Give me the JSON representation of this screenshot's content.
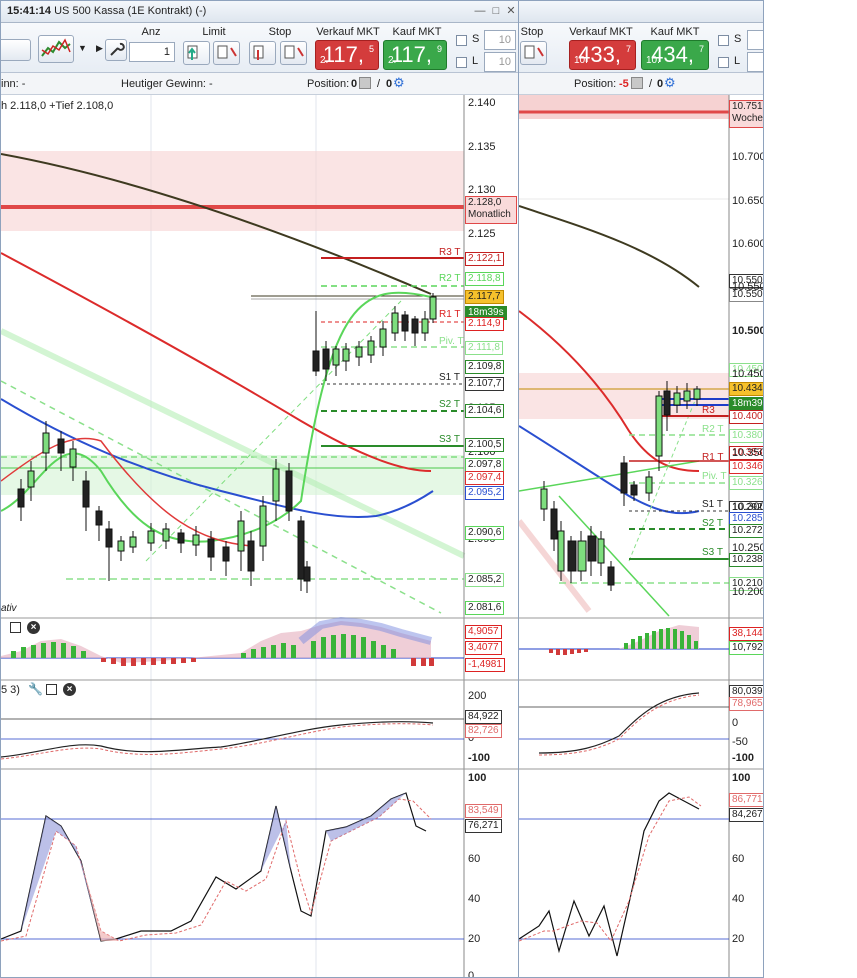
{
  "left_window": {
    "time": "15:41:14",
    "title": "US 500 Kassa (1E Kontrakt) (-)",
    "toolbar": {
      "anz_label": "Anz",
      "anz_value": "1",
      "limit_label": "Limit",
      "stop_label": "Stop",
      "sell_label": "Verkauf MKT",
      "buy_label": "Kauf MKT",
      "sell_small": "2.",
      "sell_big": "117,",
      "sell_sup": "5",
      "buy_small": "2.",
      "buy_big": "117,",
      "buy_sup": "9"
    },
    "infobar": {
      "gain_prefix": "inn:  -",
      "today_gain": "Heutiger Gewinn:  -",
      "position_label": "Position:",
      "position_value": "0",
      "position_value2": "0"
    },
    "chart_header": "h 2.118,0 +Tief 2.108,0",
    "price_axis": [
      "2.140",
      "2.135",
      "2.130",
      "2.125",
      "2.120",
      "2.115",
      "2.110",
      "2.105",
      "2.100",
      "2.095",
      "2.090",
      "2.085"
    ],
    "tags": {
      "monthly_value": "2.128,0",
      "monthly_label": "Monatlich",
      "r3": "2.122,1",
      "r2": "2.118,8",
      "last": "2.117,7",
      "timer": "18m39s",
      "r1": "2.114,9",
      "piv": "2.111,8",
      "a": "2.109,8",
      "s1": "2.107,7",
      "s2": "2.104,6",
      "s3": "2.100,5",
      "b": "2.097,8",
      "c": "2.097,4",
      "d": "2.095,2",
      "e": "2.090,6",
      "f": "2.085,2",
      "g": "2.081,6"
    },
    "pivot_labels": {
      "r3": "R3 T",
      "r2": "R2 T",
      "r1": "R1 T",
      "piv": "Piv. T",
      "s1": "S1 T",
      "s2": "S2 T",
      "s3": "S3 T"
    },
    "bottom_text": "ativ",
    "macd_tags": [
      "4,9057",
      "3,4077",
      "-1,4981"
    ],
    "cci_header": "5 3)",
    "cci_axis": [
      "200",
      "0",
      "-100"
    ],
    "cci_tags": [
      "84,922",
      "82,726"
    ],
    "stoch_axis": [
      "100",
      "60",
      "40",
      "20",
      "0"
    ],
    "stoch_tags": [
      "83,549",
      "76,271"
    ]
  },
  "right_window": {
    "toolbar": {
      "stop_label": "Stop",
      "sell_label": "Verkauf MKT",
      "buy_label": "Kauf MKT",
      "sell_small": "10.",
      "sell_big": "433,",
      "sell_sup": "7",
      "buy_small": "10.",
      "buy_big": "434,",
      "buy_sup": "7",
      "s_label": "S",
      "l_label": "L"
    },
    "infobar": {
      "position_label": "Position:",
      "position_value": "-5",
      "position_value2": "0"
    },
    "price_axis": [
      "10.700",
      "10.650",
      "10.600",
      "10.550",
      "10.500",
      "10.450",
      "10.350",
      "10.300",
      "10.250",
      "10.200"
    ],
    "tags": {
      "weekly_value": "10.751",
      "weekly_label": "Woche",
      "t550a": "10.550",
      "t550b": "10.550",
      "t450": "10.450",
      "last": "10.434",
      "timer": "18m39",
      "t400": "10.400",
      "t380": "10.380",
      "t353": "10.353",
      "t346": "10.346",
      "t326": "10.326",
      "t292": "10.292",
      "t285": "10.285",
      "t272": "10.272",
      "t238": "10.238",
      "t210": "10.210"
    },
    "pivot_labels": {
      "r3": "R3",
      "r2": "R2 T",
      "r1": "R1 T",
      "piv": "Piv. T",
      "s1": "S1 T",
      "s2": "S2 T",
      "s3": "S3 T"
    },
    "macd_tags": [
      "38,144",
      "10,792"
    ],
    "cci_axis": [
      "0",
      "-50",
      "-100"
    ],
    "cci_tags": [
      "80,039",
      "78,965"
    ],
    "stoch_axis": [
      "100",
      "60",
      "40",
      "20"
    ],
    "stoch_tags": [
      "86,771",
      "84,267"
    ]
  },
  "left_s_label": "S",
  "left_l_label": "L",
  "left_s_value": "10",
  "left_l_value": "10"
}
